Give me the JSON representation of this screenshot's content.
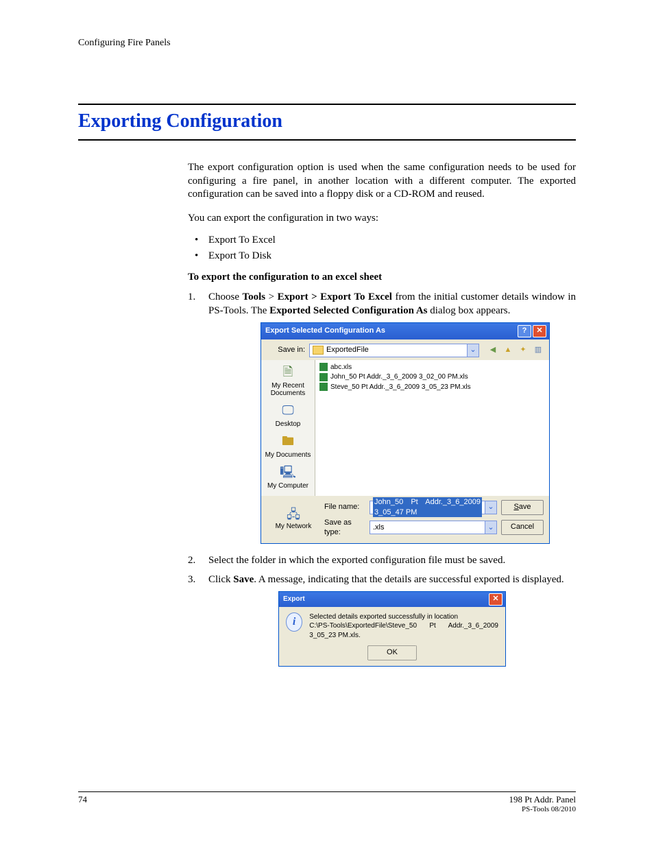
{
  "header": {
    "running": "Configuring Fire Panels"
  },
  "section": {
    "title": "Exporting Configuration"
  },
  "intro": {
    "p1": "The export configuration option is used when the same configuration needs to be used for configuring a fire panel, in another location with a different computer. The exported configuration can be saved into a floppy disk or a CD-ROM and reused.",
    "p2": "You can export the configuration in two ways:"
  },
  "bullets": {
    "b1": "Export To Excel",
    "b2": "Export To Disk"
  },
  "subhead": {
    "excel": "To export the configuration to an excel sheet"
  },
  "steps": {
    "s1_a": "Choose ",
    "s1_b": "Tools",
    "s1_c": " > ",
    "s1_d": "Export > Export To Excel",
    "s1_e": " from the initial customer details window in PS-Tools. The ",
    "s1_f": "Exported Selected Configuration As",
    "s1_g": " dialog box appears.",
    "s2": "Select the folder in which the exported configuration file must be saved.",
    "s3_a": "Click ",
    "s3_b": "Save",
    "s3_c": ". A message, indicating that the details are successful exported is displayed."
  },
  "dialog": {
    "title": "Export Selected Configuration As",
    "savein_label": "Save in:",
    "savein_value": "ExportedFile",
    "places": {
      "recent": "My Recent Documents",
      "desktop": "Desktop",
      "mydocs": "My Documents",
      "mycomp": "My Computer",
      "mynet": "My Network"
    },
    "files": {
      "f1": "abc.xls",
      "f2": "John_50 Pt Addr._3_6_2009 3_02_00 PM.xls",
      "f3": "Steve_50 Pt Addr._3_6_2009 3_05_23 PM.xls"
    },
    "filename_label": "File name:",
    "filename_value": "John_50 Pt Addr._3_6_2009 3_05_47 PM",
    "savetype_label": "Save as type:",
    "savetype_value": ".xls",
    "btn_save": "Save",
    "btn_cancel": "Cancel"
  },
  "msg": {
    "title": "Export",
    "line1": "Selected details exported successfully in location",
    "line2": "C:\\PS-Tools\\ExportedFile\\Steve_50 Pt Addr._3_6_2009 3_05_23 PM.xls.",
    "ok": "OK"
  },
  "footer": {
    "page": "74",
    "right1": "198 Pt Addr. Panel",
    "right2": "PS-Tools   08/2010"
  },
  "glyph": {
    "help": "?",
    "close": "✕",
    "chev": "⌄",
    "back": "◀",
    "up": "▲",
    "new": "✦",
    "view": "▥",
    "docs": "🗎",
    "desk": "🖵",
    "folder": "🖿",
    "comp": "🖳",
    "net": "🖧",
    "info": "i"
  }
}
